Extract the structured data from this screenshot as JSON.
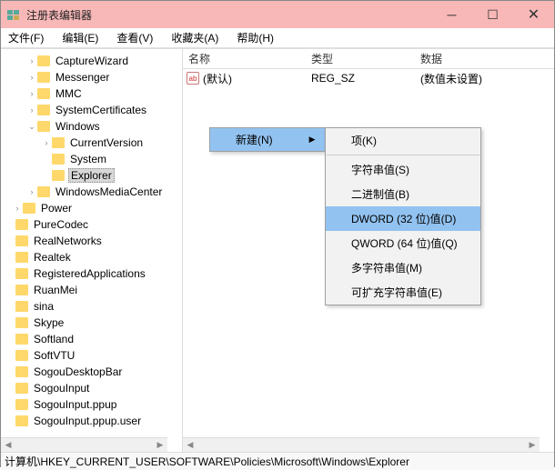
{
  "window": {
    "title": "注册表编辑器"
  },
  "menubar": {
    "file": "文件(F)",
    "edit": "编辑(E)",
    "view": "查看(V)",
    "favorites": "收藏夹(A)",
    "help": "帮助(H)"
  },
  "tree": {
    "items": [
      {
        "indent": 24,
        "exp": "›",
        "label": "CaptureWizard"
      },
      {
        "indent": 24,
        "exp": "›",
        "label": "Messenger"
      },
      {
        "indent": 24,
        "exp": "›",
        "label": "MMC"
      },
      {
        "indent": 24,
        "exp": "›",
        "label": "SystemCertificates"
      },
      {
        "indent": 24,
        "exp": "⌄",
        "label": "Windows"
      },
      {
        "indent": 40,
        "exp": "›",
        "label": "CurrentVersion"
      },
      {
        "indent": 40,
        "exp": "",
        "label": "System"
      },
      {
        "indent": 40,
        "exp": "",
        "label": "Explorer",
        "sel": true
      },
      {
        "indent": 24,
        "exp": "›",
        "label": "WindowsMediaCenter"
      },
      {
        "indent": 8,
        "exp": "›",
        "label": "Power"
      },
      {
        "indent": 0,
        "exp": "",
        "label": "PureCodec"
      },
      {
        "indent": 0,
        "exp": "",
        "label": "RealNetworks"
      },
      {
        "indent": 0,
        "exp": "",
        "label": "Realtek"
      },
      {
        "indent": 0,
        "exp": "",
        "label": "RegisteredApplications"
      },
      {
        "indent": 0,
        "exp": "",
        "label": "RuanMei"
      },
      {
        "indent": 0,
        "exp": "",
        "label": "sina"
      },
      {
        "indent": 0,
        "exp": "",
        "label": "Skype"
      },
      {
        "indent": 0,
        "exp": "",
        "label": "Softland"
      },
      {
        "indent": 0,
        "exp": "",
        "label": "SoftVTU"
      },
      {
        "indent": 0,
        "exp": "",
        "label": "SogouDesktopBar"
      },
      {
        "indent": 0,
        "exp": "",
        "label": "SogouInput"
      },
      {
        "indent": 0,
        "exp": "",
        "label": "SogouInput.ppup"
      },
      {
        "indent": 0,
        "exp": "",
        "label": "SogouInput.ppup.user"
      }
    ]
  },
  "list": {
    "headers": {
      "name": "名称",
      "type": "类型",
      "data": "数据"
    },
    "rows": [
      {
        "icon": "ab",
        "name": "(默认)",
        "type": "REG_SZ",
        "data": "(数值未设置)"
      }
    ]
  },
  "context1": {
    "new": "新建(N)"
  },
  "context2": {
    "key": "项(K)",
    "string": "字符串值(S)",
    "binary": "二进制值(B)",
    "dword": "DWORD (32 位)值(D)",
    "qword": "QWORD (64 位)值(Q)",
    "multi": "多字符串值(M)",
    "expand": "可扩充字符串值(E)"
  },
  "statusbar": {
    "path": "计算机\\HKEY_CURRENT_USER\\SOFTWARE\\Policies\\Microsoft\\Windows\\Explorer"
  }
}
